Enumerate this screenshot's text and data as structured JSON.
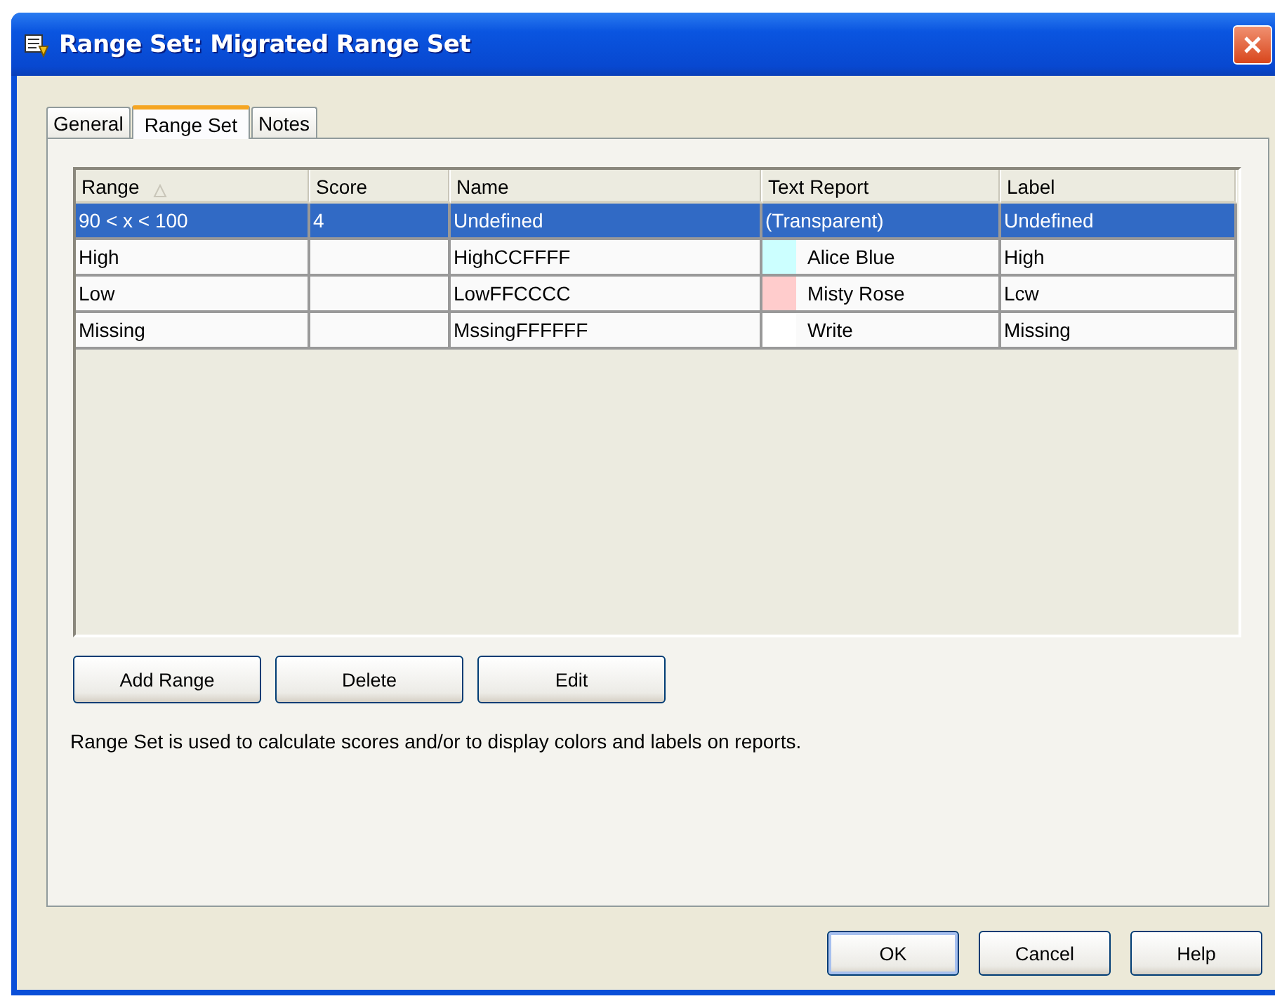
{
  "window": {
    "title": "Range Set: Migrated Range Set"
  },
  "tabs": [
    {
      "label": "General",
      "selected": false
    },
    {
      "label": "Range Set",
      "selected": true
    },
    {
      "label": "Notes",
      "selected": false
    }
  ],
  "table": {
    "columns": [
      {
        "label": "Range",
        "sorted": true
      },
      {
        "label": "Score",
        "sorted": false
      },
      {
        "label": "Name",
        "sorted": false
      },
      {
        "label": "Text Report",
        "sorted": false
      },
      {
        "label": "Label",
        "sorted": false
      }
    ],
    "rows": [
      {
        "selected": true,
        "range": "90 < x < 100",
        "score": "4",
        "name": "Undefined",
        "text_report": "(Transparent)",
        "label": "Undefined"
      },
      {
        "selected": false,
        "range": "High",
        "name": "HighCCFFFF",
        "text_report": "Alice Blue",
        "color": "#ccffff",
        "label": "High"
      },
      {
        "selected": false,
        "range": "Low",
        "name": "LowFFCCCC",
        "text_report": "Misty Rose",
        "color": "#ffcccc",
        "label": "Lcw"
      },
      {
        "selected": false,
        "range": "Missing",
        "name": "MssingFFFFFF",
        "text_report": "Write",
        "color": "#ffffff",
        "label": "Missing"
      }
    ]
  },
  "actions": [
    "Add Range",
    "Delete",
    "Edit"
  ],
  "description": "Range Set is used to calculate scores and/or to display colors and labels on reports.",
  "buttons": [
    {
      "label": "OK",
      "default": true
    },
    {
      "label": "Cancel",
      "default": false
    },
    {
      "label": "Help",
      "default": false
    }
  ]
}
